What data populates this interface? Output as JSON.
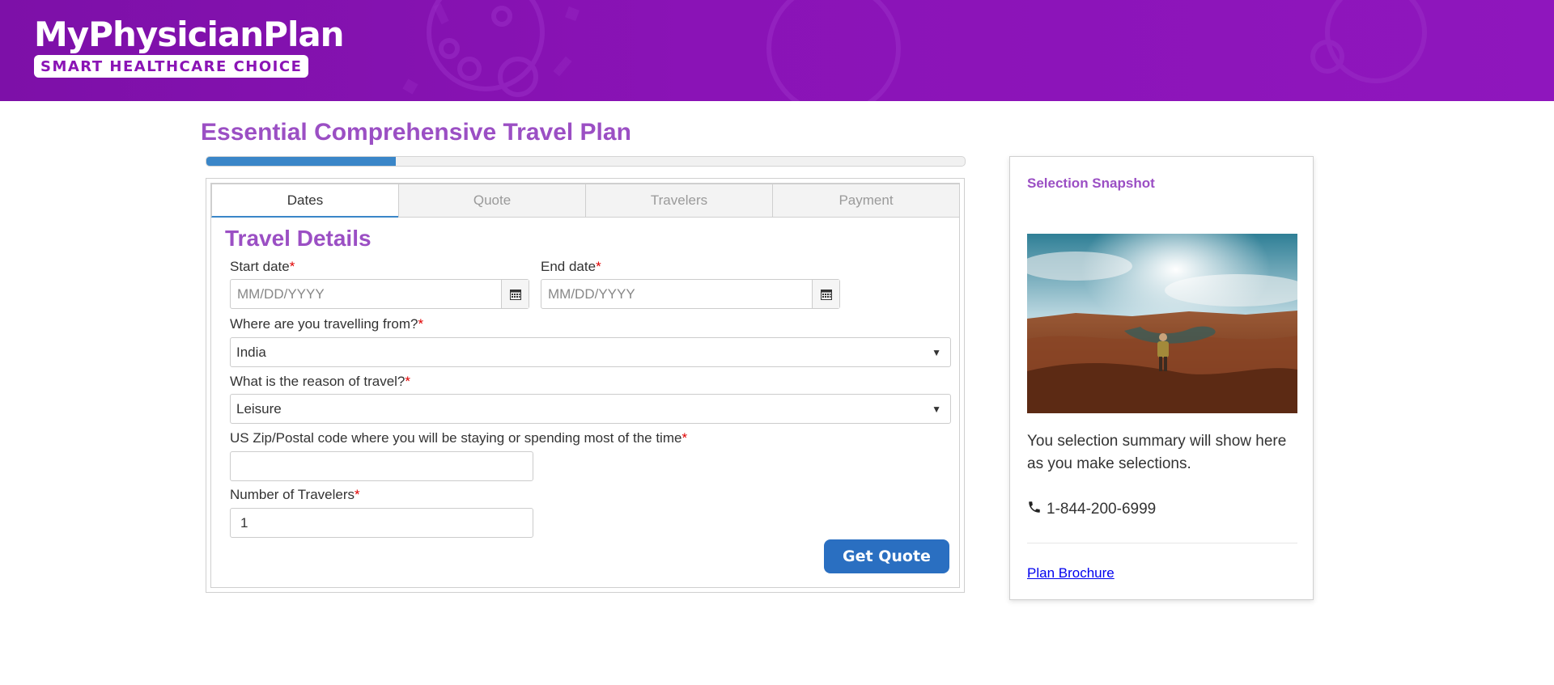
{
  "header": {
    "logo_title": "MyPhysicianPlan",
    "logo_tagline": "SMART HEALTHCARE CHOICE",
    "background_color": "#8a13b6"
  },
  "page": {
    "title": "Essential Comprehensive Travel Plan",
    "progress_fraction": 0.25
  },
  "tabs": [
    {
      "label": "Dates",
      "active": true
    },
    {
      "label": "Quote",
      "active": false
    },
    {
      "label": "Travelers",
      "active": false
    },
    {
      "label": "Payment",
      "active": false
    }
  ],
  "form": {
    "section_title": "Travel Details",
    "required_marker": "*",
    "start_date": {
      "label": "Start date",
      "placeholder": "MM/DD/YYYY",
      "value": ""
    },
    "end_date": {
      "label": "End date",
      "placeholder": "MM/DD/YYYY",
      "value": ""
    },
    "travel_from": {
      "label": "Where are you travelling from?",
      "value": "India"
    },
    "travel_reason": {
      "label": "What is the reason of travel?",
      "value": "Leisure"
    },
    "zip": {
      "label": "US Zip/Postal code where you will be staying or spending most of the time",
      "value": ""
    },
    "travelers": {
      "label": "Number of Travelers",
      "value": "1"
    },
    "submit_label": "Get Quote"
  },
  "snapshot": {
    "title": "Selection Snapshot",
    "summary_text": "You selection summary will show here as you make selections.",
    "phone": "1-844-200-6999",
    "brochure_link": "Plan Brochure"
  },
  "colors": {
    "accent_purple": "#9b4fc4",
    "progress_blue": "#3a86c8",
    "button_blue": "#2a6fc1",
    "required_red": "#e00000"
  },
  "icons": {
    "calendar": "calendar-icon",
    "phone": "phone-icon",
    "dropdown": "chevron-down-icon"
  }
}
